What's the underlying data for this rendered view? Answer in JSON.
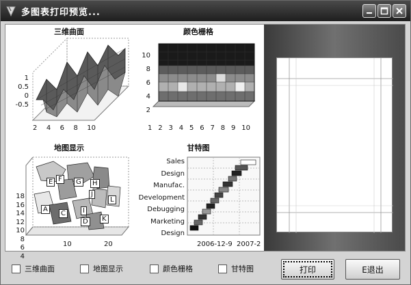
{
  "window": {
    "title": "多图表打印预览...",
    "controls": [
      "minimize-icon",
      "maximize-icon",
      "close-icon"
    ]
  },
  "charts": {
    "surface": {
      "title": "三维曲面",
      "y_ticks": [
        "1",
        "0.5",
        "0",
        "-0.5"
      ],
      "x_ticks": [
        "2",
        "4",
        "6",
        "8",
        "10"
      ]
    },
    "color_grid": {
      "title": "颜色栅格",
      "y_ticks": [
        "10",
        "8",
        "6",
        "4",
        "2"
      ],
      "x_ticks": [
        "1",
        "2",
        "3",
        "4",
        "5",
        "6",
        "7",
        "8",
        "9",
        "10"
      ]
    },
    "map": {
      "title": "地图显示",
      "y_ticks": [
        "18",
        "16",
        "14",
        "12",
        "10",
        "8",
        "6",
        "4"
      ],
      "x_ticks": [
        "10",
        "20"
      ],
      "region_labels": [
        "E",
        "F",
        "G",
        "H",
        "J",
        "L",
        "A",
        "C",
        "I",
        "D",
        "K"
      ]
    },
    "gantt": {
      "title": "甘特图",
      "tasks": [
        "Sales",
        "Design",
        "Manufac.",
        "Development",
        "Debugging",
        "Marketing",
        "Design"
      ],
      "x_ticks": [
        "2006-12-9",
        "2007-2"
      ]
    }
  },
  "checkboxes": [
    {
      "label": "三维曲面",
      "checked": false
    },
    {
      "label": "地图显示",
      "checked": false
    },
    {
      "label": "颜色栅格",
      "checked": false
    },
    {
      "label": "甘特图",
      "checked": false
    }
  ],
  "buttons": {
    "print": "打印",
    "exit": "E退出"
  }
}
